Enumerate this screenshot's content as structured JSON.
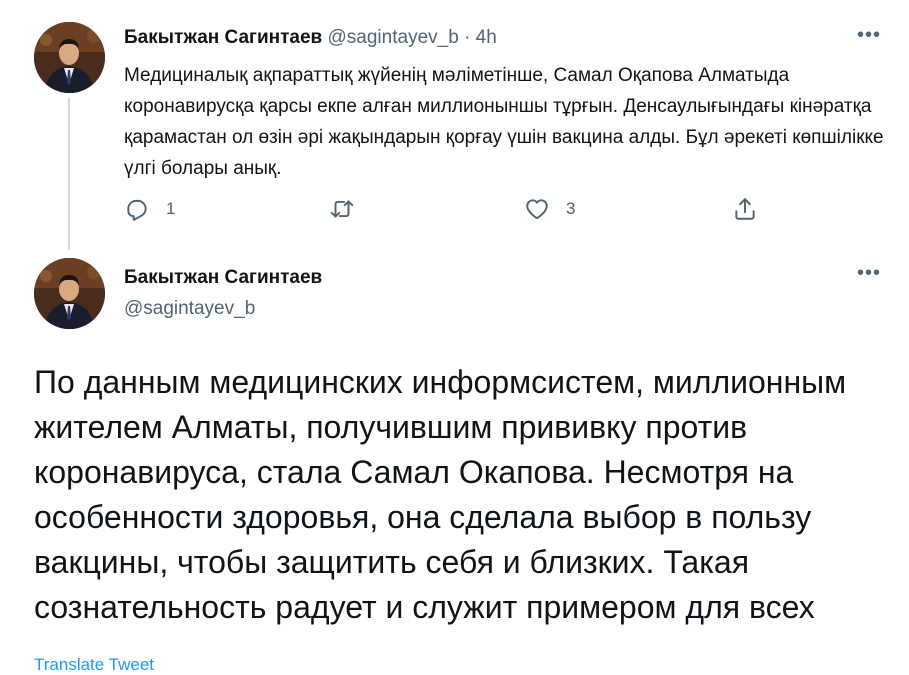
{
  "tweet1": {
    "name": "Бакытжан Сагинтаев",
    "handle": "@sagintayev_b",
    "separator": "·",
    "time": "4h",
    "more_label": "•••",
    "text": "Медициналық ақпараттық жүйенің мәліметінше, Самал Оқапова Алматыда коронавирусқа қарсы екпе алған миллионыншы тұрғын. Денсаулығындағы кінәратқа қарамастан ол өзін әрі жақындарын қорғау үшін вакцина алды. Бұл әрекеті көпшілікке үлгі болары анық.",
    "actions": {
      "reply_icon": "reply-icon",
      "reply_count": "1",
      "retweet_icon": "retweet-icon",
      "like_icon": "heart-icon",
      "like_count": "3",
      "share_icon": "share-icon"
    }
  },
  "tweet2": {
    "name": "Бакытжан Сагинтаев",
    "handle": "@sagintayev_b",
    "more_label": "•••",
    "text": "По данным медицинских информсистем, миллионным жителем Алматы, получившим прививку против коронавируса, стала Самал Окапова. Несмотря на особенности здоровья, она сделала выбор в пользу вакцины, чтобы защитить себя и близких. Такая сознательность радует и служит примером для всех",
    "translate_label": "Translate Tweet"
  },
  "colors": {
    "text": "#0f1419",
    "muted": "#536471",
    "link": "#1d9bf0",
    "thread_line": "#cfd9de"
  }
}
